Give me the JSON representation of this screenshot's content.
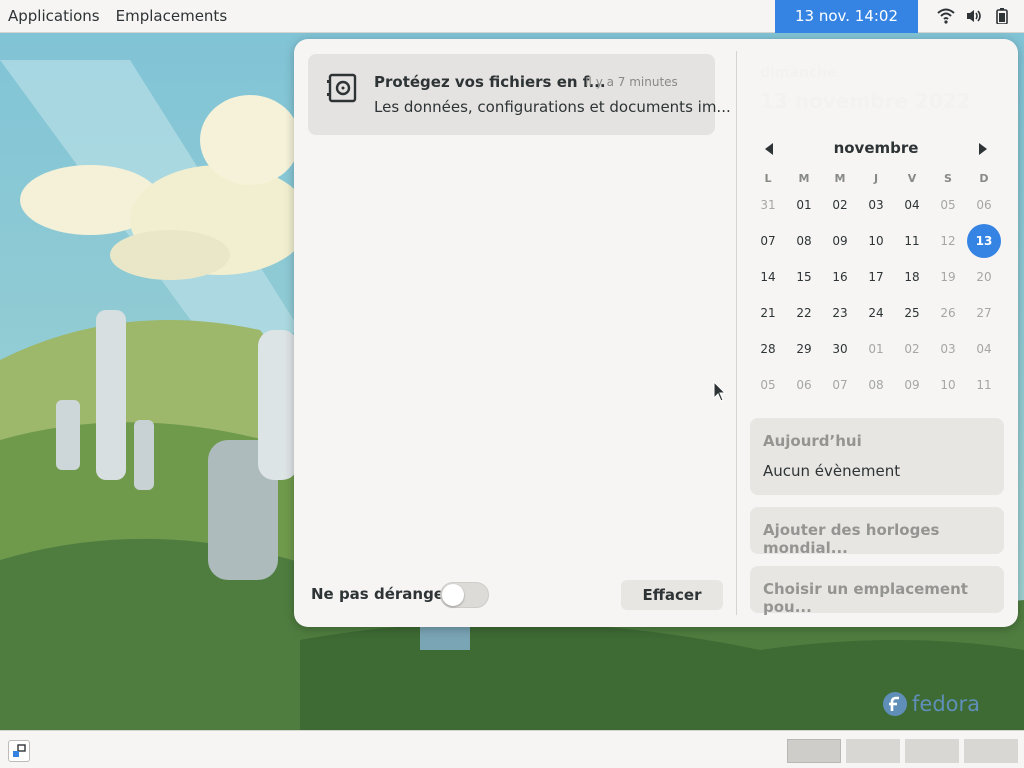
{
  "topbar": {
    "menus": [
      "Applications",
      "Emplacements"
    ],
    "clock": "13 nov.  14:02",
    "icons": [
      "wifi-icon",
      "volume-icon",
      "battery-icon"
    ]
  },
  "notification": {
    "icon": "safe-icon",
    "title": "Protégez vos fichiers en f...",
    "time": "Il y a 7 minutes",
    "body": "Les données, configurations et documents im..."
  },
  "footer": {
    "dnd_label": "Ne pas déranger",
    "dnd_enabled": false,
    "clear_label": "Effacer"
  },
  "calendar": {
    "day_name": "dimanche",
    "full_date": "13 novembre 2022",
    "month": "novembre",
    "weekday_headers": [
      "L",
      "M",
      "M",
      "J",
      "V",
      "S",
      "D"
    ],
    "weeks": [
      [
        "31",
        "01",
        "02",
        "03",
        "04",
        "05",
        "06"
      ],
      [
        "07",
        "08",
        "09",
        "10",
        "11",
        "12",
        "13"
      ],
      [
        "14",
        "15",
        "16",
        "17",
        "18",
        "19",
        "20"
      ],
      [
        "21",
        "22",
        "23",
        "24",
        "25",
        "26",
        "27"
      ],
      [
        "28",
        "29",
        "30",
        "01",
        "02",
        "03",
        "04"
      ],
      [
        "05",
        "06",
        "07",
        "08",
        "09",
        "10",
        "11"
      ]
    ],
    "today": "13"
  },
  "events": {
    "title": "Aujourd’hui",
    "empty": "Aucun évènement"
  },
  "world_clocks": {
    "label": "Ajouter des horloges mondial..."
  },
  "weather": {
    "label": "Choisir un emplacement pou..."
  },
  "branding": {
    "logo_text": "fedora"
  },
  "colors": {
    "accent": "#3584e4",
    "panel": "#f6f5f4"
  }
}
